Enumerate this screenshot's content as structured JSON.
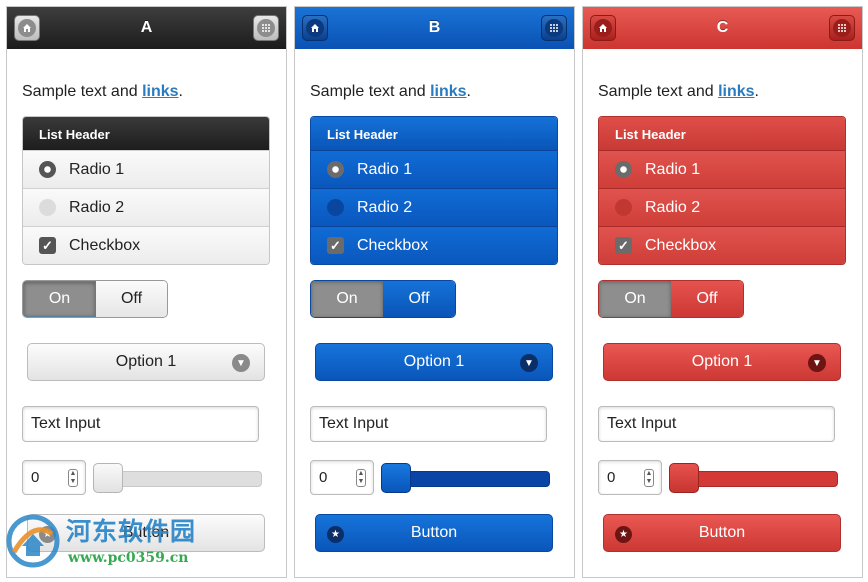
{
  "panels": [
    {
      "id": "A",
      "title": "A",
      "sample_text": "Sample text and ",
      "link_text": "links",
      "sample_end": ".",
      "list_header": "List Header",
      "radio1": "Radio 1",
      "radio2": "Radio 2",
      "checkbox": "Checkbox",
      "toggle_on": "On",
      "toggle_off": "Off",
      "select_value": "Option 1",
      "text_input": "Text Input",
      "number_value": "0",
      "slider_value": 0,
      "button": "Button",
      "accent": "#1c1c1c"
    },
    {
      "id": "B",
      "title": "B",
      "sample_text": "Sample text and ",
      "link_text": "links",
      "sample_end": ".",
      "list_header": "List Header",
      "radio1": "Radio 1",
      "radio2": "Radio 2",
      "checkbox": "Checkbox",
      "toggle_on": "On",
      "toggle_off": "Off",
      "select_value": "Option 1",
      "text_input": "Text Input",
      "number_value": "0",
      "slider_value": 0,
      "button": "Button",
      "accent": "#0a56ba"
    },
    {
      "id": "C",
      "title": "C",
      "sample_text": "Sample text and ",
      "link_text": "links",
      "sample_end": ".",
      "list_header": "List Header",
      "radio1": "Radio 1",
      "radio2": "Radio 2",
      "checkbox": "Checkbox",
      "toggle_on": "On",
      "toggle_off": "Off",
      "select_value": "Option 1",
      "text_input": "Text Input",
      "number_value": "0",
      "slider_value": 0,
      "button": "Button",
      "accent": "#cc3833"
    }
  ],
  "icons": {
    "header_left": "home-icon",
    "header_right": "grid-icon",
    "select": "chevron-down-icon",
    "button": "star-icon"
  },
  "watermark": {
    "name": "河东软件园",
    "url": "www.pc0359.cn"
  }
}
